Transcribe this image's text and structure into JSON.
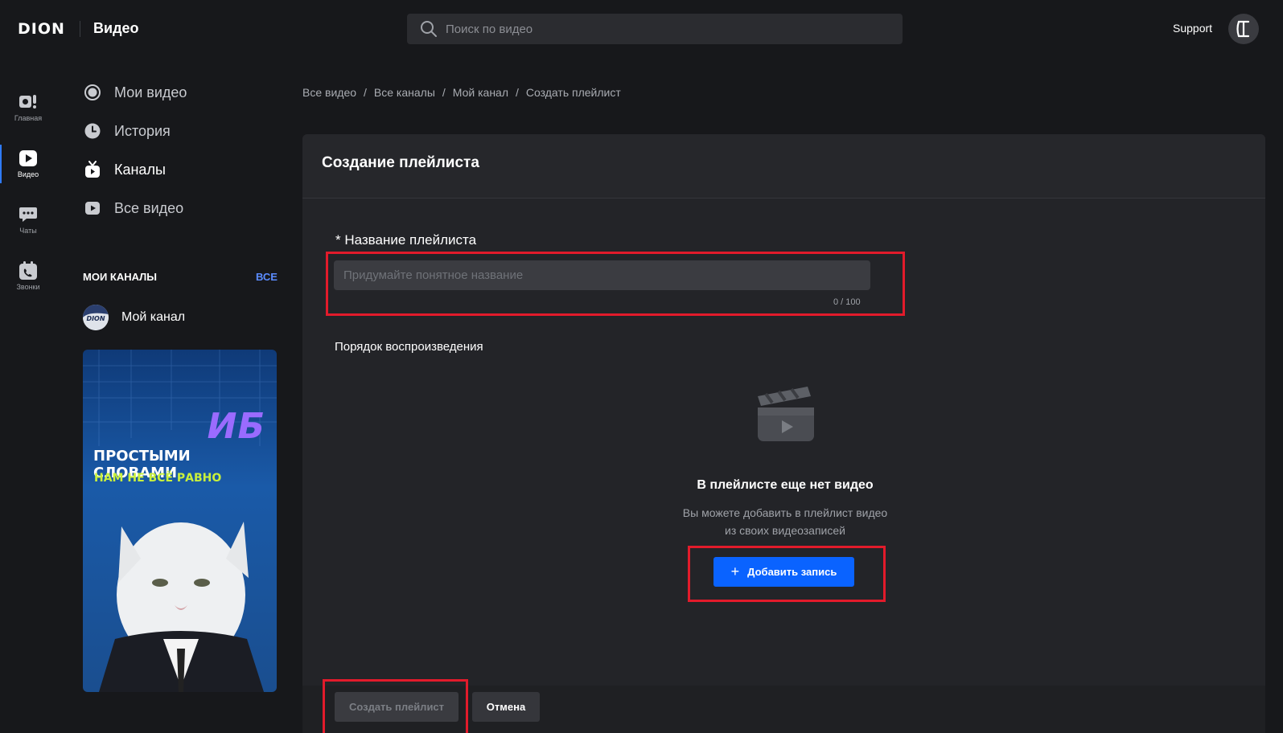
{
  "app": {
    "logo": "DION",
    "title": "Видео"
  },
  "search": {
    "placeholder": "Поиск по видео",
    "icon": "search-icon"
  },
  "topbar": {
    "support": "Support",
    "avatar_icon": "profile-logo-icon"
  },
  "rail": {
    "items": [
      {
        "label": "Главная",
        "icon": "home-icon"
      },
      {
        "label": "Видео",
        "icon": "video-icon",
        "active": true
      },
      {
        "label": "Чаты",
        "icon": "chat-icon"
      },
      {
        "label": "Звонки",
        "icon": "calls-icon"
      }
    ]
  },
  "nav": {
    "items": [
      {
        "label": "Мои видео",
        "icon": "my-videos-icon"
      },
      {
        "label": "История",
        "icon": "history-icon"
      },
      {
        "label": "Каналы",
        "icon": "channels-icon",
        "active": true
      },
      {
        "label": "Все видео",
        "icon": "all-videos-icon"
      }
    ]
  },
  "my_channels": {
    "title": "МОИ КАНАЛЫ",
    "all_link": "ВСЕ",
    "channels": [
      {
        "name": "Мой канал",
        "avatar_text": "DION"
      }
    ]
  },
  "banner": {
    "headline": "ИБ",
    "line1": "ПРОСТЫМИ СЛОВАМИ",
    "line2": "НАМ НЕ ВСЁ РАВНО"
  },
  "breadcrumb": [
    {
      "label": "Все видео"
    },
    {
      "label": "Все каналы"
    },
    {
      "label": "Мой канал"
    },
    {
      "label": "Создать плейлист",
      "current": true
    }
  ],
  "form": {
    "title": "Создание плейлиста",
    "name_label": "* Название плейлиста",
    "name_placeholder": "Придумайте понятное название",
    "name_value": "",
    "counter": "0 / 100",
    "order_label": "Порядок воспроизведения",
    "empty_title": "В плейлисте еще нет видео",
    "empty_desc_line1": "Вы можете добавить в плейлист видео",
    "empty_desc_line2": "из своих видеозаписей",
    "add_button": "Добавить запись",
    "create_button": "Создать плейлист",
    "cancel_button": "Отмена"
  },
  "colors": {
    "accent": "#0a63ff",
    "highlight": "#e21b2b",
    "background": "#17181b",
    "panel": "#232428"
  }
}
